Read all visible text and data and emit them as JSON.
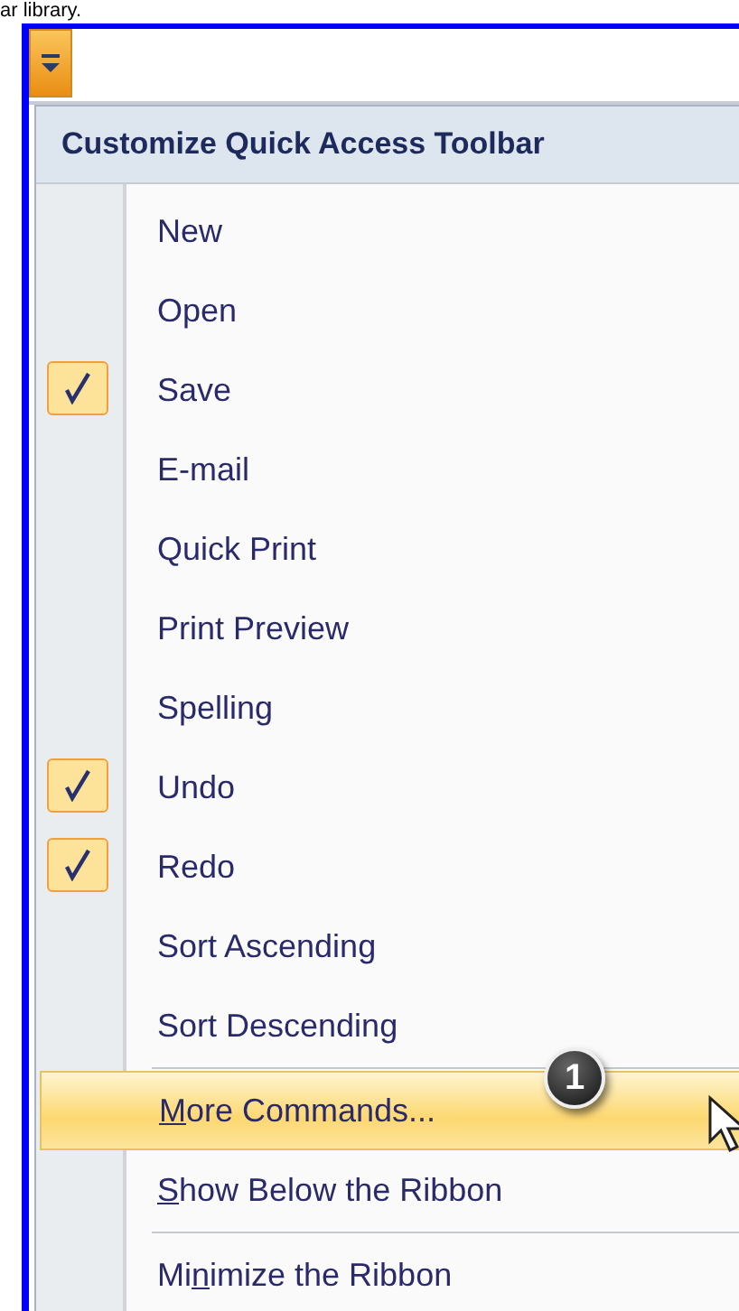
{
  "caption": "ar library.",
  "menu": {
    "title": "Customize Quick Access Toolbar",
    "items": [
      {
        "kind": "command",
        "label": "New",
        "checked": false
      },
      {
        "kind": "command",
        "label": "Open",
        "checked": false
      },
      {
        "kind": "command",
        "label": "Save",
        "checked": true
      },
      {
        "kind": "command",
        "label": "E-mail",
        "checked": false
      },
      {
        "kind": "command",
        "label": "Quick Print",
        "checked": false
      },
      {
        "kind": "command",
        "label": "Print Preview",
        "checked": false
      },
      {
        "kind": "command",
        "label": "Spelling",
        "checked": false
      },
      {
        "kind": "command",
        "label": "Undo",
        "checked": true
      },
      {
        "kind": "command",
        "label": "Redo",
        "checked": true
      },
      {
        "kind": "command",
        "label": "Sort Ascending",
        "checked": false
      },
      {
        "kind": "command",
        "label": "Sort Descending",
        "checked": false
      },
      {
        "kind": "separator"
      },
      {
        "kind": "action",
        "key": "M",
        "after": "ore Commands...",
        "selected": true,
        "callout": "1"
      },
      {
        "kind": "action",
        "key": "S",
        "after": "how Below the Ribbon",
        "selected": false
      },
      {
        "kind": "separator"
      },
      {
        "kind": "action",
        "before": "Mi",
        "key": "n",
        "after": "imize the Ribbon",
        "selected": false
      }
    ]
  }
}
